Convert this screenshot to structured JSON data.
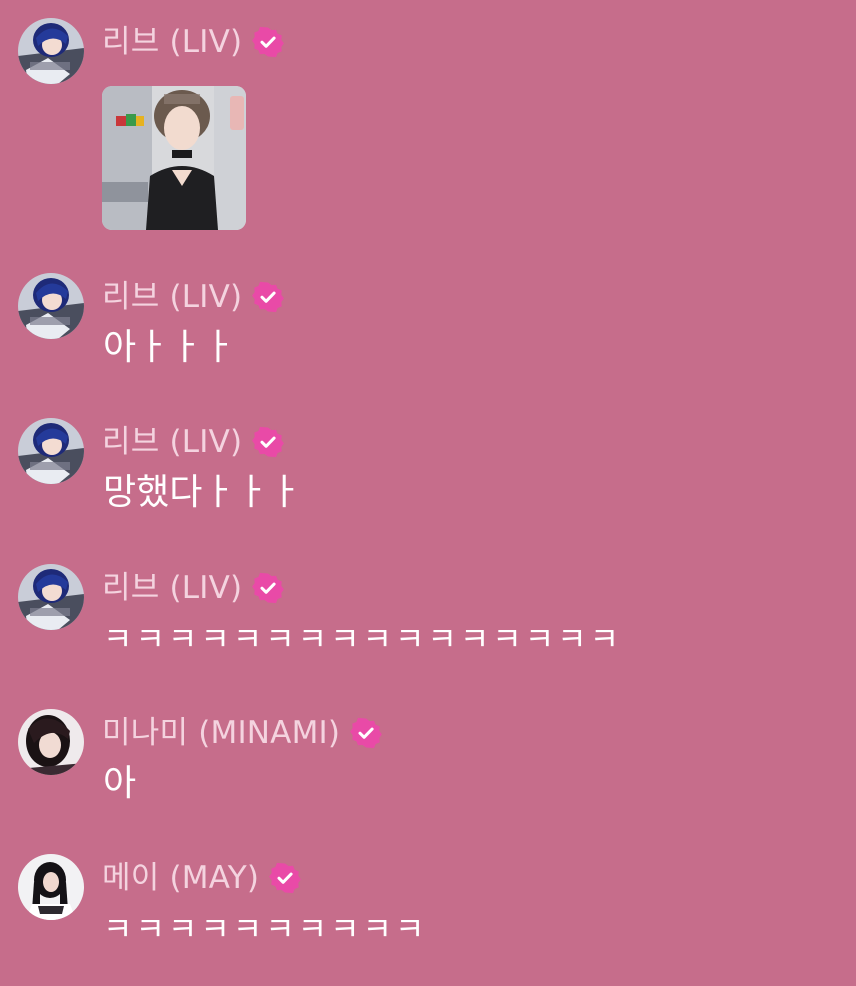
{
  "colors": {
    "background": "#c66d8b",
    "name_text": "#f4d3df",
    "message_text": "#ffffff",
    "verified_badge": "#e94aa7"
  },
  "messages": [
    {
      "sender": "리브 (LIV)",
      "verified_icon": "verified-badge-icon",
      "type": "photo",
      "text": ""
    },
    {
      "sender": "리브 (LIV)",
      "verified_icon": "verified-badge-icon",
      "type": "text",
      "text": "아ㅏㅏㅏ"
    },
    {
      "sender": "리브 (LIV)",
      "verified_icon": "verified-badge-icon",
      "type": "text",
      "text": "망했다ㅏㅏㅏ"
    },
    {
      "sender": "리브 (LIV)",
      "verified_icon": "verified-badge-icon",
      "type": "text",
      "text": "ㅋㅋㅋㅋㅋㅋㅋㅋㅋㅋㅋㅋㅋㅋㅋㅋ"
    },
    {
      "sender": "미나미 (MINAMI)",
      "verified_icon": "verified-badge-icon",
      "type": "text",
      "text": "아"
    },
    {
      "sender": "메이 (MAY)",
      "verified_icon": "verified-badge-icon",
      "type": "text",
      "text": "ㅋㅋㅋㅋㅋㅋㅋㅋㅋㅋ"
    }
  ]
}
